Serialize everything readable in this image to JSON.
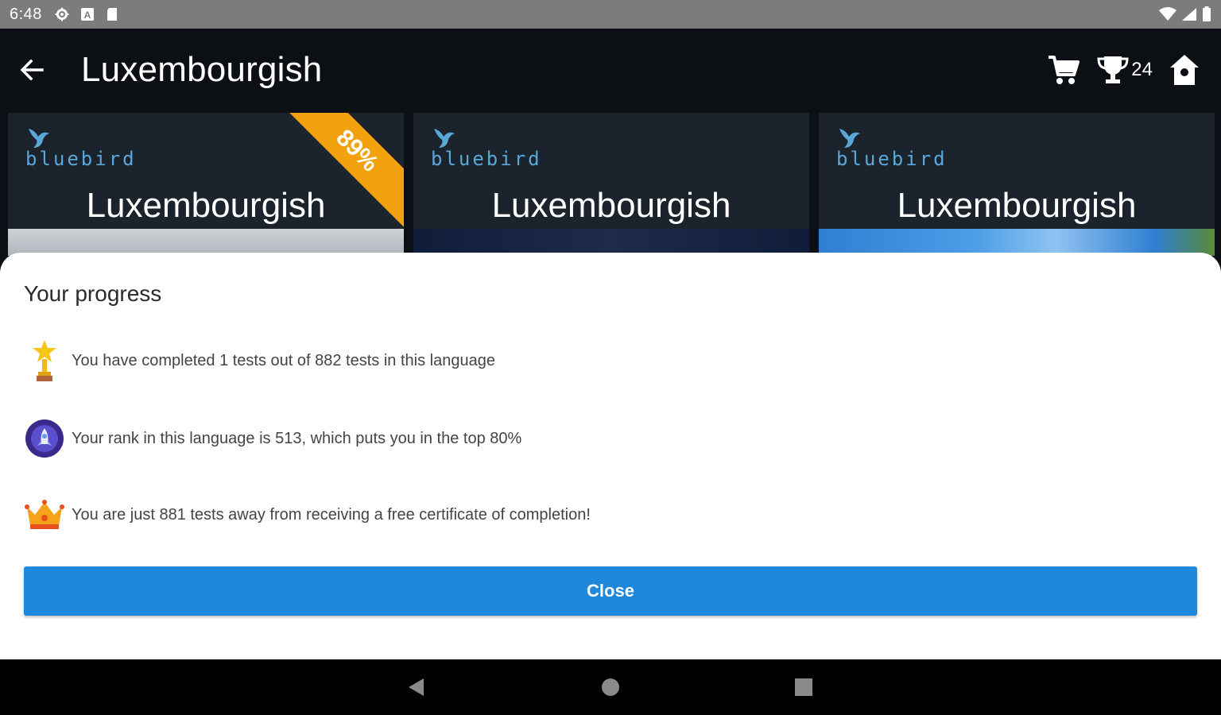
{
  "status_bar": {
    "time": "6:48"
  },
  "app_bar": {
    "title": "Luxembourgish",
    "trophy_count": "24"
  },
  "cards": [
    {
      "brand": "bluebird",
      "title": "Luxembourgish",
      "badge": "89%"
    },
    {
      "brand": "bluebird",
      "title": "Luxembourgish"
    },
    {
      "brand": "bluebird",
      "title": "Luxembourgish"
    }
  ],
  "dialog": {
    "title": "Your progress",
    "rows": [
      {
        "icon": "trophy-star-icon",
        "text": "You have completed 1 tests out of 882 tests in this language"
      },
      {
        "icon": "rank-medal-icon",
        "text": "Your rank in this language is 513, which puts you in the top 80%"
      },
      {
        "icon": "crown-icon",
        "text": "You are just 881 tests away from receiving a free certificate of completion!"
      }
    ],
    "close_label": "Close"
  },
  "colors": {
    "accent": "#1e88dc",
    "ribbon": "#f2a20e",
    "brand": "#5aa7d8",
    "card_bg": "#1b232d"
  }
}
